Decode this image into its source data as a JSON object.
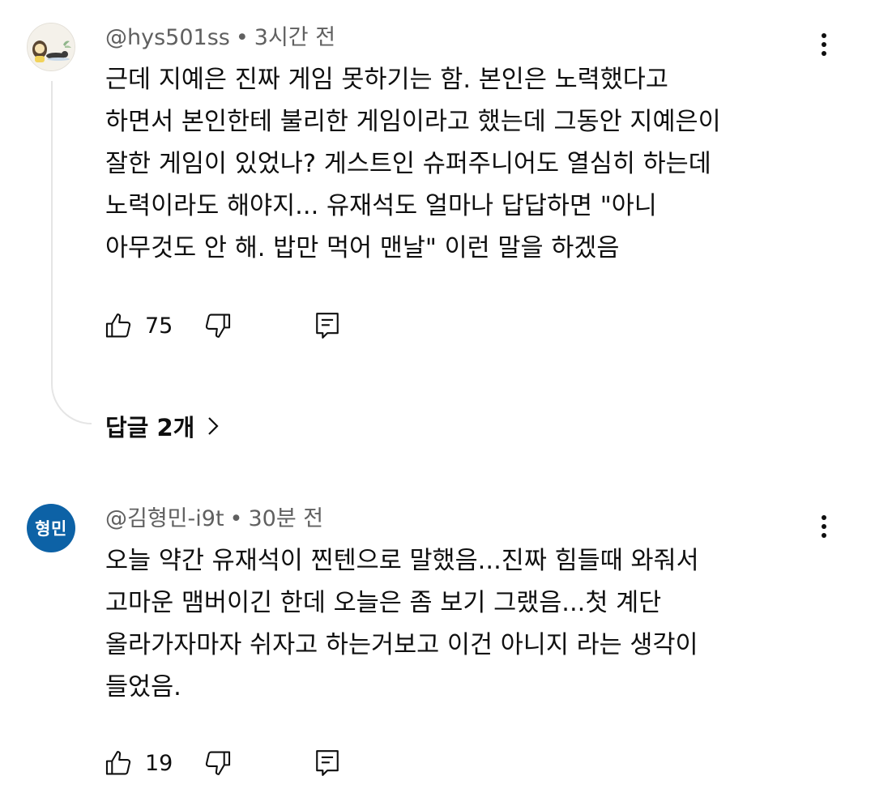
{
  "comments": [
    {
      "author": "@hys501ss",
      "separator": "•",
      "time": "3시간 전",
      "lines": [
        "근데 지예은 진짜 게임 못하기는 함. 본인은 노력했다고",
        "하면서 본인한테 불리한 게임이라고 했는데 그동안 지예은이",
        "잘한 게임이 있었나? 게스트인 슈퍼주니어도 열심히 하는데",
        "노력이라도 해야지... 유재석도 얼마나 답답하면 \"아니",
        "아무것도 안 해. 밥만 먹어 맨날\" 이런 말을 하겠음"
      ],
      "likes": "75",
      "replies_label": "답글 2개"
    },
    {
      "author": "@김형민-i9t",
      "separator": "•",
      "time": "30분 전",
      "avatar_text": "형민",
      "lines": [
        "오늘 약간 유재석이 찐텐으로 말했음...진짜 힘들때 와줘서",
        "고마운 맴버이긴 한데 오늘은 좀 보기 그랬음...첫 계단",
        "올라가자마자 쉬자고 하는거보고 이건 아니지 라는 생각이",
        "들었음."
      ],
      "likes": "19"
    }
  ],
  "icons": {
    "like": "thumbs-up-icon",
    "dislike": "thumbs-down-icon",
    "reply": "reply-comment-icon",
    "more": "more-vertical-icon",
    "chevron": "chevron-right-icon"
  },
  "colors": {
    "text": "#0f0f0f",
    "secondary_text": "#606060",
    "avatar_blue": "#0d62a6",
    "thread_line": "#e5e5e5"
  }
}
